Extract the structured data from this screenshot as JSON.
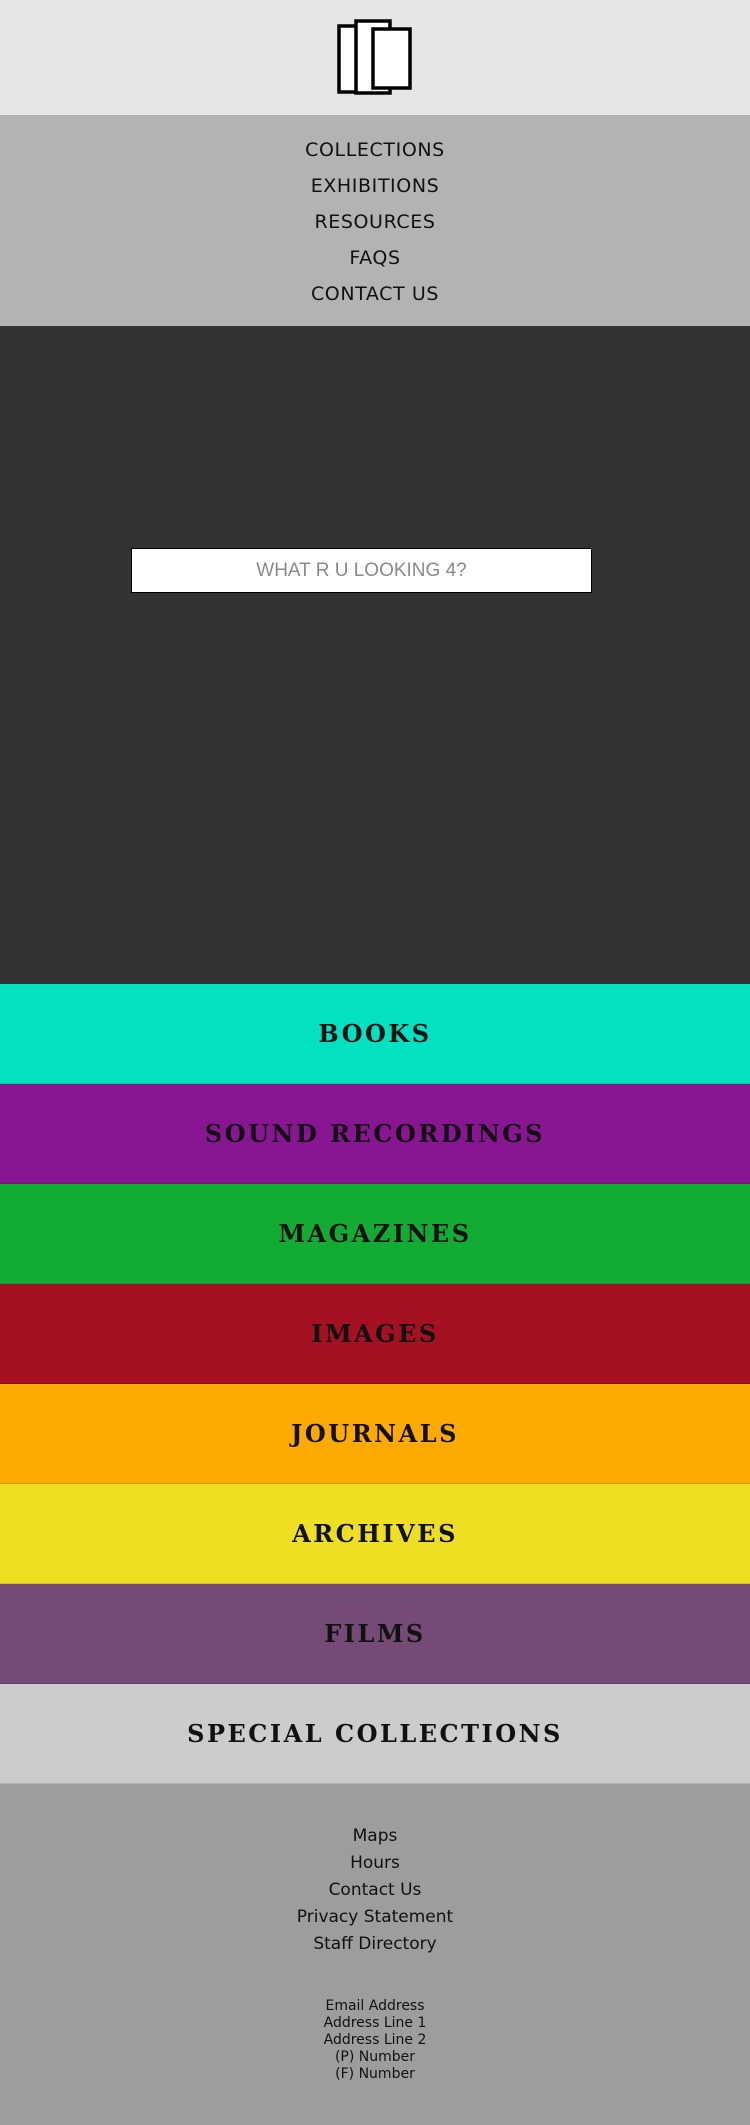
{
  "nav": {
    "items": [
      {
        "label": "COLLECTIONS"
      },
      {
        "label": "EXHIBITIONS"
      },
      {
        "label": "RESOURCES"
      },
      {
        "label": "FAQS"
      },
      {
        "label": "CONTACT US"
      }
    ]
  },
  "search": {
    "placeholder": "WHAT R U LOOKING 4?"
  },
  "categories": [
    {
      "label": "BOOKS",
      "color": "#02e2c0"
    },
    {
      "label": "SOUND RECORDINGS",
      "color": "#881591"
    },
    {
      "label": "MAGAZINES",
      "color": "#12ac34"
    },
    {
      "label": "IMAGES",
      "color": "#a51122"
    },
    {
      "label": "JOURNALS",
      "color": "#feaa01"
    },
    {
      "label": "ARCHIVES",
      "color": "#efdf22"
    },
    {
      "label": "FILMS",
      "color": "#764a76"
    },
    {
      "label": "SPECIAL COLLECTIONS",
      "color": "#cccccc"
    }
  ],
  "footer": {
    "links": [
      {
        "label": "Maps"
      },
      {
        "label": "Hours"
      },
      {
        "label": "Contact Us"
      },
      {
        "label": "Privacy Statement"
      },
      {
        "label": "Staff Directory"
      }
    ],
    "contact": {
      "email": "Email Address",
      "address1": "Address Line 1",
      "address2": "Address Line 2",
      "phone": "(P) Number",
      "fax": "(F) Number"
    }
  },
  "colors": {
    "logo_bar": "#e6e6e6",
    "nav_bg": "#b3b3b3",
    "hero_bg": "#333333",
    "footer_bg": "#9d9d9d"
  }
}
